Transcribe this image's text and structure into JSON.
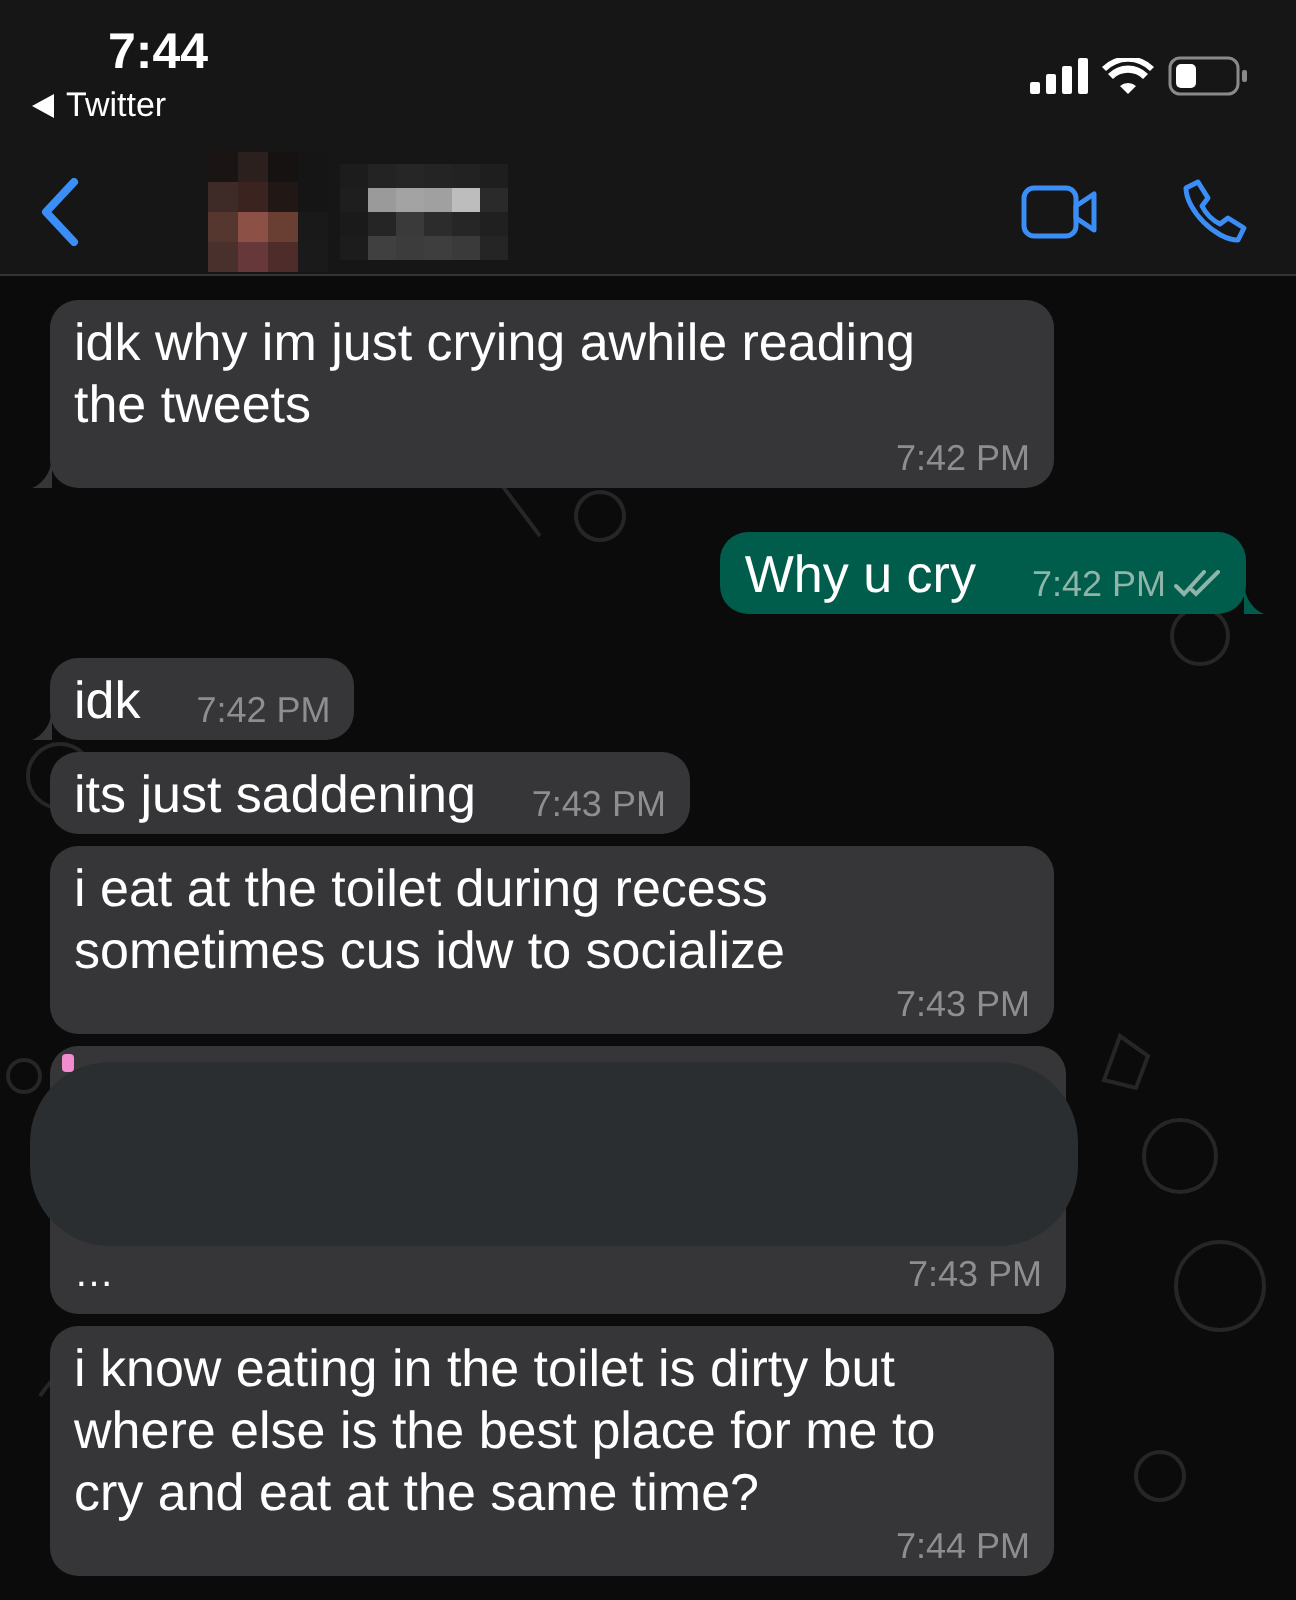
{
  "status_bar": {
    "time": "7:44",
    "back_app": "Twitter"
  },
  "messages": [
    {
      "kind": "incoming",
      "text": "idk why im just crying awhile reading the tweets",
      "time": "7:42 PM",
      "tail": true
    },
    {
      "kind": "outgoing",
      "text": "Why u cry",
      "time": "7:42 PM",
      "tail": true,
      "read": false
    },
    {
      "kind": "incoming",
      "text": "idk",
      "time": "7:42 PM",
      "tail": true
    },
    {
      "kind": "incoming",
      "text": "its just saddening",
      "time": "7:43 PM",
      "tail": false
    },
    {
      "kind": "incoming",
      "text": "i eat at the toilet during recess sometimes cus idw to socialize",
      "time": "7:43 PM",
      "tail": false
    },
    {
      "kind": "redacted",
      "text": "…",
      "time": "7:43 PM",
      "tail": false
    },
    {
      "kind": "incoming",
      "text": "i know eating in the toilet is dirty but where else is the best place for me to cry and eat at the same time?",
      "time": "7:44 PM",
      "tail": false
    }
  ]
}
